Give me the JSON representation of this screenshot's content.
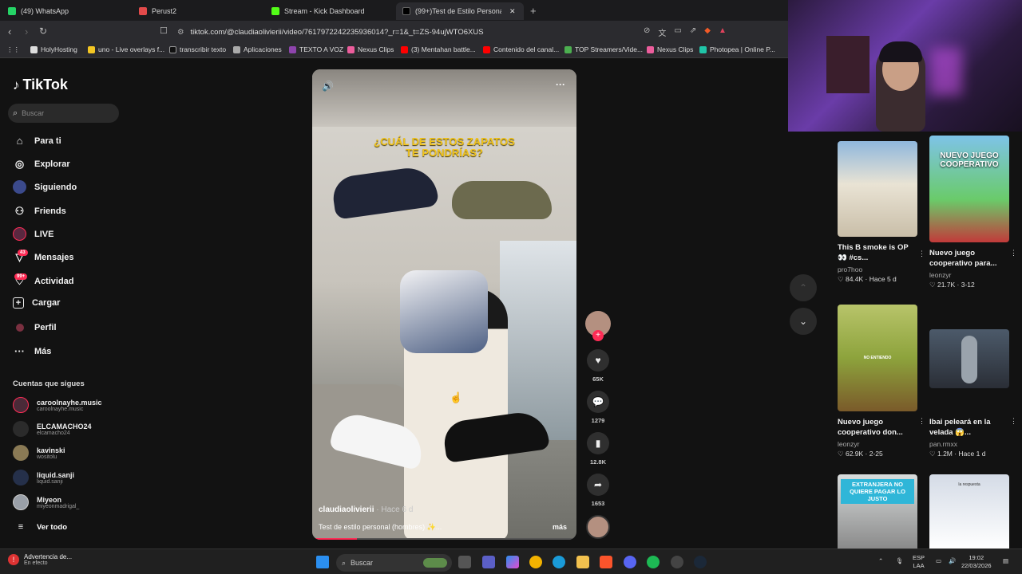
{
  "browser": {
    "tabs": [
      {
        "label": "(49) WhatsApp",
        "color": "#25d366"
      },
      {
        "label": "Perust2",
        "color": "#e24a4a"
      },
      {
        "label": "Stream - Kick Dashboard",
        "color": "#53fc18"
      },
      {
        "label": "(99+)Test de Estilo Personal M",
        "color": "#222222"
      }
    ],
    "url": "tiktok.com/@claudiaolivierii/video/7617972242235936014?_r=1&_t=ZS-94ujWTO6XUS",
    "bookmarks": [
      "HolyHosting",
      "uno - Live overlays f...",
      "transcribir texto",
      "Aplicaciones",
      "TEXTO A VOZ",
      "Nexus Clips",
      "(3) Mentahan battle...",
      "Contenido del canal...",
      "TOP Streamers/Vide...",
      "Nexus Clips",
      "Photopea | Online P..."
    ]
  },
  "sidebar": {
    "logo": "TikTok",
    "search_placeholder": "Buscar",
    "items": [
      {
        "label": "Para ti",
        "icon": "home-icon"
      },
      {
        "label": "Explorar",
        "icon": "compass-icon"
      },
      {
        "label": "Siguiendo",
        "icon": "following-avatar-icon"
      },
      {
        "label": "Friends",
        "icon": "friends-icon"
      },
      {
        "label": "LIVE",
        "icon": "live-icon"
      },
      {
        "label": "Mensajes",
        "icon": "message-icon",
        "badge": "43"
      },
      {
        "label": "Actividad",
        "icon": "activity-icon",
        "badge": "99+"
      },
      {
        "label": "Cargar",
        "icon": "upload-icon"
      },
      {
        "label": "Perfil",
        "icon": "profile-icon"
      },
      {
        "label": "Más",
        "icon": "more-icon"
      }
    ],
    "following_title": "Cuentas que sigues",
    "following": [
      {
        "name": "caroolnayhe.music",
        "handle": "caroolnayhe.music"
      },
      {
        "name": "ELCAMACHO24",
        "handle": "elcamacho24"
      },
      {
        "name": "kavinski",
        "handle": "wositolu"
      },
      {
        "name": "liquid.sanji",
        "handle": "liquid.sanji"
      },
      {
        "name": "Miyeon",
        "handle": "miyeonmadrigal_"
      }
    ],
    "see_all": "Ver todo"
  },
  "video": {
    "overlay_title_line1": "¿CUÁL DE ESTOS ZAPATOS",
    "overlay_title_line2": "TE PONDRÍAS?",
    "author": "claudiaolivierii",
    "time": "· Hace 6 d",
    "description": "Test de estilo personal (hombres) ✨...",
    "more": "más",
    "progress": 0.17,
    "likes": "65K",
    "comments": "1279",
    "saves": "12.8K",
    "shares": "1653"
  },
  "grid": [
    {
      "title": "This B smoke is OP 👀 #cs...",
      "author": "pro7hoo",
      "stats": "♡ 84.4K · Hace 5 d"
    },
    {
      "title": "Nuevo juego cooperativo para...",
      "author": "leonzyr",
      "stats": "♡ 21.7K · 3-12",
      "thumb_text": "NUEVO JUEGO COOPERATIVO"
    },
    {
      "title": "Nuevo juego cooperativo don...",
      "author": "leonzyr",
      "stats": "♡ 62.9K · 2-25",
      "thumb_text": "NO ENTIENDO"
    },
    {
      "title": "Ibai peleará en la velada 😱...",
      "author": "pan.rmxx",
      "stats": "♡ 1.2M · Hace 1 d"
    },
    {
      "thumb_text": "EXTRANJERA NO QUIERE PAGAR LO JUSTO"
    },
    {
      "thumb_text": "la respuesta"
    }
  ],
  "taskbar": {
    "warning_title": "Advertencia de...",
    "warning_sub": "En efecto",
    "search": "Buscar",
    "lang1": "ESP",
    "lang2": "LAA",
    "time": "19:02",
    "date": "22/03/2026"
  }
}
